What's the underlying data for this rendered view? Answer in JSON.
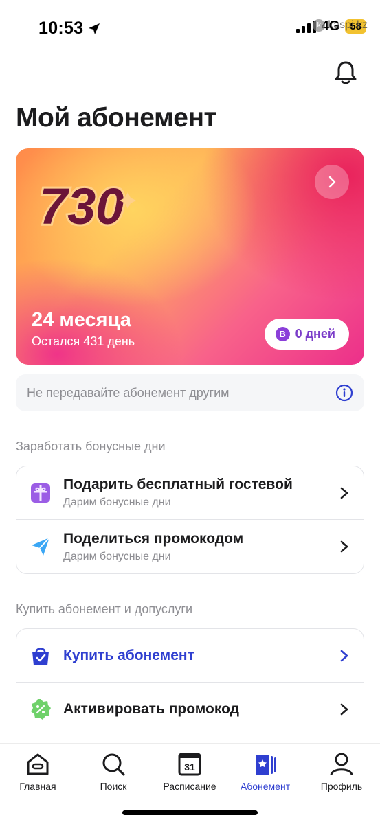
{
  "status_bar": {
    "time": "10:53",
    "network": "4G",
    "battery": "58",
    "watermark": "kaspi.kz"
  },
  "header": {
    "title": "Мой абонемент",
    "bell_icon": "bell-icon"
  },
  "subscription_card": {
    "logo_text": "730",
    "duration": "24 месяца",
    "remaining": "Остался 431 день",
    "bonus_badge_letter": "B",
    "bonus_days": "0 дней",
    "gradient_colors": [
      "#ff8a4a",
      "#ffb458",
      "#f8628a",
      "#ec2f8a"
    ]
  },
  "notice": {
    "text": "Не передавайте абонемент другим",
    "icon": "info-icon"
  },
  "bonus_section": {
    "label": "Заработать бонусные дни",
    "items": [
      {
        "title": "Подарить бесплатный гостевой",
        "subtitle": "Дарим бонусные дни",
        "icon": "gift-icon"
      },
      {
        "title": "Поделиться промокодом",
        "subtitle": "Дарим бонусные дни",
        "icon": "send-icon"
      }
    ]
  },
  "buy_section": {
    "label": "Купить абонемент и допуслуги",
    "items": [
      {
        "title": "Купить абонемент",
        "icon": "shopping-bag-icon"
      },
      {
        "title": "Активировать промокод",
        "icon": "promo-badge-icon"
      }
    ]
  },
  "tab_bar": {
    "tabs": [
      {
        "label": "Главная",
        "icon": "home-icon"
      },
      {
        "label": "Поиск",
        "icon": "search-icon"
      },
      {
        "label": "Расписание",
        "icon": "calendar-icon",
        "calendar_day": "31"
      },
      {
        "label": "Абонемент",
        "icon": "membership-card-icon",
        "active": true
      },
      {
        "label": "Профиль",
        "icon": "profile-icon"
      }
    ]
  },
  "colors": {
    "accent": "#2f3fd0",
    "bonus_purple": "#7b3dc9"
  }
}
